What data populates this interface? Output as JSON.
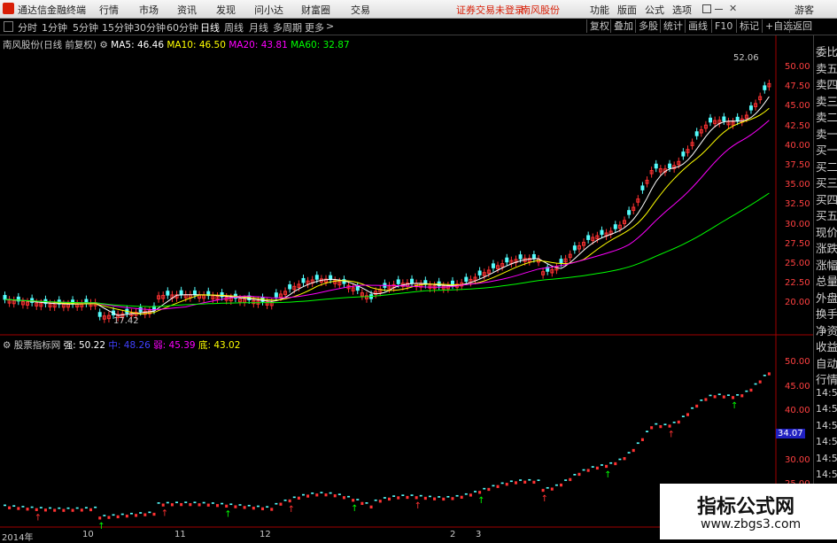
{
  "titlebar": {
    "app_title": "通达信金融终端",
    "menu": [
      "行情",
      "市场",
      "资讯",
      "发现",
      "问小达",
      "财富圈",
      "交易"
    ],
    "notice": "证券交易未登录",
    "stock_name": "南风股份",
    "right_menu": [
      "功能",
      "版面",
      "公式",
      "选项"
    ],
    "guest": "游客"
  },
  "periods": [
    "分时",
    "1分钟",
    "5分钟",
    "15分钟",
    "30分钟",
    "60分钟",
    "日线",
    "周线",
    "月线",
    "多周期",
    "更多"
  ],
  "active_period": "日线",
  "toolbar_right": [
    "复权",
    "叠加",
    "多股",
    "统计",
    "画线",
    "F10",
    "标记",
    "+自选",
    "返回"
  ],
  "main_legend": {
    "title": "南风股份(日线 前复权)",
    "ma5": "MA5: 46.46",
    "ma10": "MA10: 46.50",
    "ma20": "MA20: 43.81",
    "ma60": "MA60: 32.87"
  },
  "price_axis": [
    "50.00",
    "47.50",
    "45.00",
    "42.50",
    "40.00",
    "37.50",
    "35.00",
    "32.50",
    "30.00",
    "27.50",
    "25.00",
    "22.50",
    "20.00"
  ],
  "high_label": "52.06",
  "low_label": "17.42",
  "sub_legend": {
    "title": "股票指标网",
    "strong": "强: 50.22",
    "mid": "中: 48.26",
    "weak": "弱: 45.39",
    "bottom": "底: 43.02"
  },
  "sub_axis": [
    "50.00",
    "45.00",
    "40.00",
    "34.07",
    "30.00",
    "25.00"
  ],
  "right_panel": [
    "委比",
    "卖五",
    "卖四",
    "卖三",
    "卖二",
    "卖一",
    "买一",
    "买二",
    "买三",
    "买四",
    "买五",
    "现价",
    "涨跌",
    "涨幅",
    "总量",
    "外盘",
    "换手",
    "净资",
    "收益",
    "自动",
    "行情",
    "14:50",
    "14:50",
    "14:50",
    "14:50",
    "14:50",
    "14:50",
    "14:50",
    "14:50",
    "14:50"
  ],
  "dates": [
    "2014年",
    "10",
    "11",
    "12",
    "2",
    "3"
  ],
  "watermark": {
    "title": "指标公式网",
    "url": "www.zbgs3.com"
  },
  "colors": {
    "up": "#ff3232",
    "down": "#54fcfc",
    "ma5": "#ffffff",
    "ma10": "#ffff00",
    "ma20": "#ff00ff",
    "ma60": "#00ff00",
    "blue": "#4040ff"
  }
}
